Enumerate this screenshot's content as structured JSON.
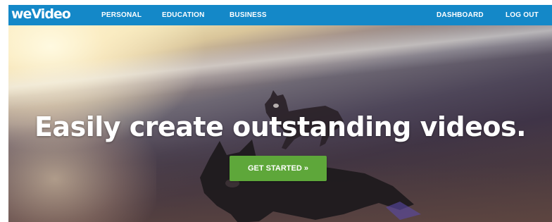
{
  "brand": {
    "logo_text": "weVideo"
  },
  "nav": {
    "left_items": [
      {
        "label": "PERSONAL"
      },
      {
        "label": "EDUCATION"
      },
      {
        "label": "BUSINESS"
      }
    ],
    "right_items": [
      {
        "label": "DASHBOARD"
      },
      {
        "label": "LOG OUT"
      }
    ]
  },
  "hero": {
    "headline": "Easily create outstanding videos.",
    "cta_label": "GET STARTED »",
    "background_description_icon": "beach-dogs-photo"
  },
  "colors": {
    "nav_bar": "#1488c8",
    "cta": "#5ea73a",
    "text": "#ffffff"
  }
}
